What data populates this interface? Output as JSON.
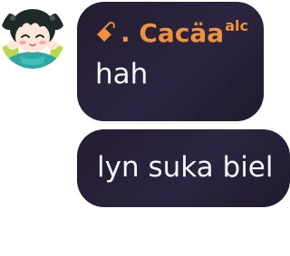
{
  "chat": {
    "messages": [
      {
        "sender": {
          "glyph": "ꗃ",
          "name": ". Cacäa",
          "tag": "alc"
        },
        "text": "hah",
        "avatar": "anime-girl-avatar"
      },
      {
        "text": "lyn suka biel"
      }
    ]
  },
  "colors": {
    "bubble_background": "#2a2339",
    "sender_name": "#f0913e",
    "message_text": "#ffffff",
    "page_background": "#ffffff"
  }
}
